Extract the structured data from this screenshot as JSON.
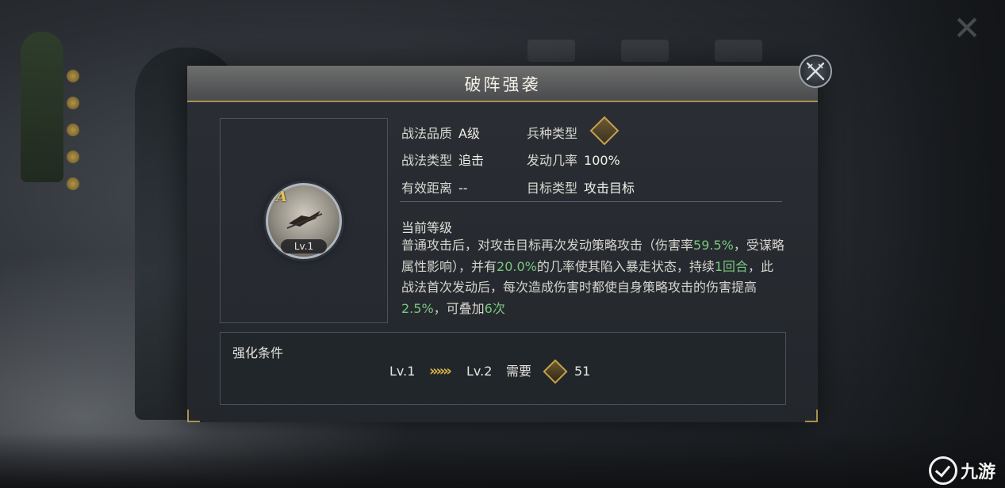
{
  "dialog": {
    "title": "破阵强袭",
    "close_icon": "crossed-swords-icon"
  },
  "skill": {
    "grade_letter": "A",
    "level_badge": "Lv.1"
  },
  "info": {
    "quality_label": "战法品质",
    "quality_value": "A级",
    "troop_label": "兵种类型",
    "troop_icon": "horse-troop-icon",
    "type_label": "战法类型",
    "type_value": "追击",
    "rate_label": "发动几率",
    "rate_value": "100%",
    "range_label": "有效距离",
    "range_value": "--",
    "target_label": "目标类型",
    "target_value": "攻击目标"
  },
  "description": {
    "title": "当前等级",
    "p1": "普通攻击后，对攻击目标再次发动策略攻击（伤害率",
    "v1": "59.5%",
    "p2": "，受谋略属性影响），并有",
    "v2": "20.0%",
    "p3": "的几率使其陷入暴走状态，持续",
    "v3": "1回合",
    "p4": "，此战法首次发动后，每次造成伤害时都使自身策略攻击的伤害提高",
    "v4": "2.5%",
    "p5": "，可叠加",
    "v5": "6次"
  },
  "upgrade": {
    "title": "强化条件",
    "from_level": "Lv.1",
    "arrows": "»»»",
    "to_level": "Lv.2",
    "need_label": "需要",
    "cost_icon": "skill-point-coin-icon",
    "cost_value": "51"
  },
  "colors": {
    "accent_gold": "#c7a24c",
    "highlight_green": "#79c67f"
  },
  "watermark": {
    "text": "九游"
  }
}
